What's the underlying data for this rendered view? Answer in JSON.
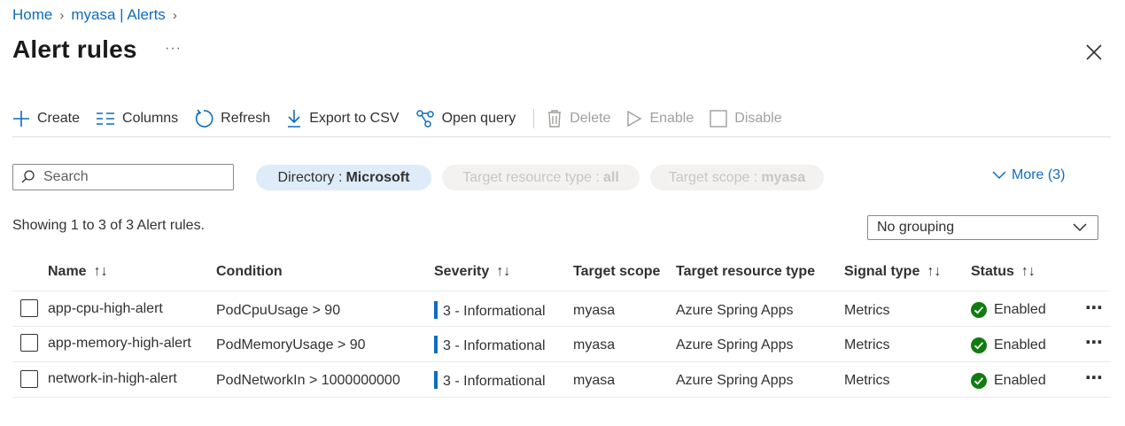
{
  "breadcrumb": [
    {
      "label": "Home"
    },
    {
      "label": "myasa | Alerts"
    }
  ],
  "page": {
    "title": "Alert rules",
    "more": "···"
  },
  "toolbar": {
    "create": "Create",
    "columns": "Columns",
    "refresh": "Refresh",
    "export": "Export to CSV",
    "open_query": "Open query",
    "delete": "Delete",
    "enable": "Enable",
    "disable": "Disable"
  },
  "filters": {
    "search_placeholder": "Search",
    "directory_label": "Directory :",
    "directory_value": "Microsoft",
    "resource_type_label": "Target resource type :",
    "resource_type_value": "all",
    "scope_label": "Target scope :",
    "scope_value": "myasa",
    "more": "More (3)"
  },
  "summary": "Showing 1 to 3 of 3 Alert rules.",
  "grouping": {
    "selected": "No grouping"
  },
  "columns": [
    "Name",
    "Condition",
    "Severity",
    "Target scope",
    "Target resource type",
    "Signal type",
    "Status"
  ],
  "rows": [
    {
      "name": "app-cpu-high-alert",
      "condition": "PodCpuUsage > 90",
      "severity": "3 - Informational",
      "scope": "myasa",
      "resource_type": "Azure Spring Apps",
      "signal": "Metrics",
      "status": "Enabled"
    },
    {
      "name": "app-memory-high-alert",
      "condition": "PodMemoryUsage > 90",
      "severity": "3 - Informational",
      "scope": "myasa",
      "resource_type": "Azure Spring Apps",
      "signal": "Metrics",
      "status": "Enabled"
    },
    {
      "name": "network-in-high-alert",
      "condition": "PodNetworkIn > 1000000000",
      "severity": "3 - Informational",
      "scope": "myasa",
      "resource_type": "Azure Spring Apps",
      "signal": "Metrics",
      "status": "Enabled"
    }
  ],
  "colors": {
    "accent": "#0f6cbd",
    "status_ok": "#107c10",
    "severity_bar": "#0f6cbd"
  }
}
